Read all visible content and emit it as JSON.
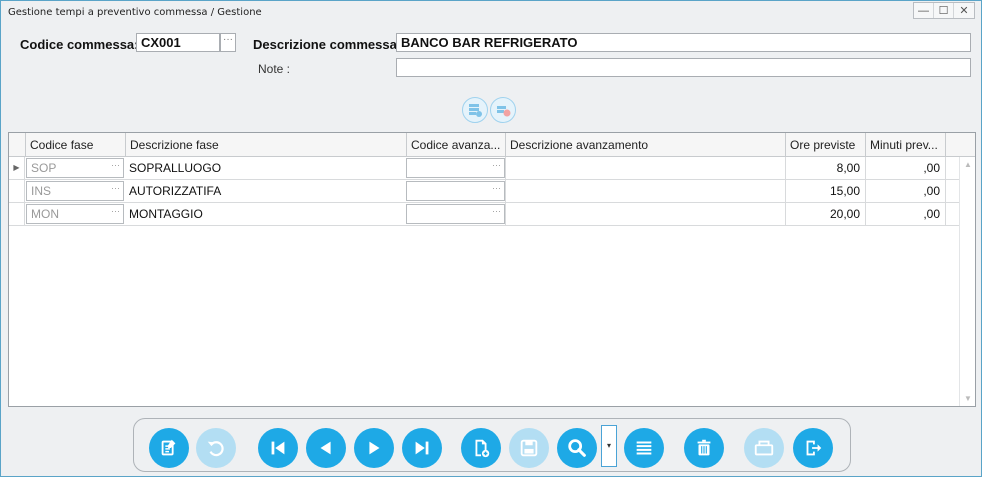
{
  "window": {
    "title": "Gestione tempi a preventivo commessa / Gestione",
    "buttons": {
      "minimize": "—",
      "maximize": "☐",
      "close": "✕"
    }
  },
  "form": {
    "codice_label": "Codice commessa:",
    "codice_value": "CX001",
    "ellipsis": "···",
    "descrizione_label": "Descrizione commessa :",
    "descrizione_value": "BANCO BAR REFRIGERATO",
    "note_label": "Note :",
    "note_value": ""
  },
  "grid": {
    "columns": [
      "Codice fase",
      "Descrizione fase",
      "Codice avanza...",
      "Descrizione avanzamento",
      "Ore previste",
      "Minuti prev..."
    ],
    "rows": [
      {
        "codice": "SOP",
        "descrizione": "SOPRALLUOGO",
        "codice_av": "",
        "descrizione_av": "",
        "ore": "8,00",
        "minuti": ",00"
      },
      {
        "codice": "INS",
        "descrizione": "AUTORIZZATIFA",
        "codice_av": "",
        "descrizione_av": "",
        "ore": "15,00",
        "minuti": ",00"
      },
      {
        "codice": "MON",
        "descrizione": "MONTAGGIO",
        "codice_av": "",
        "descrizione_av": "",
        "ore": "20,00",
        "minuti": ",00"
      }
    ],
    "current_row_marker": "▶",
    "dots": "···"
  },
  "toolbar": {
    "icons": [
      "edit-icon",
      "undo-icon",
      "first-icon",
      "previous-icon",
      "next-icon",
      "last-icon",
      "new-record-icon",
      "save-icon",
      "search-icon",
      "list-icon",
      "delete-icon",
      "print-icon",
      "exit-icon"
    ],
    "dropdown": "▾"
  },
  "colors": {
    "accent": "#1ea9e6",
    "accent_disabled": "#b3def3"
  }
}
